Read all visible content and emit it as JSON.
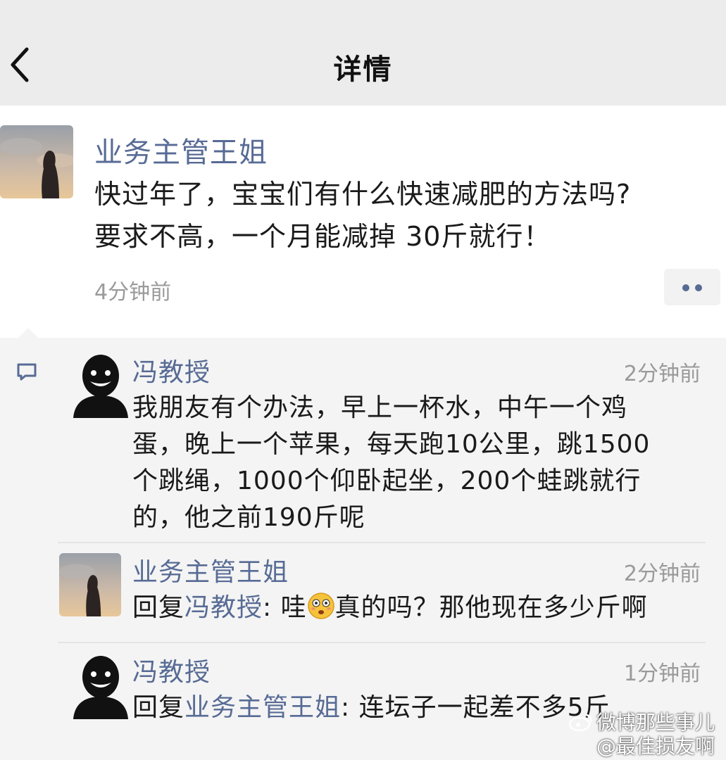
{
  "header": {
    "title": "详情"
  },
  "post": {
    "author": "业务主管王姐",
    "text_line1": "快过年了，宝宝们有什么快速减肥的方法吗?",
    "text_line2": "要求不高，一个月能减掉 30斤就行！",
    "time": "4分钟前"
  },
  "comments": [
    {
      "author": "冯教授",
      "time": "2分钟前",
      "lines": [
        "我朋友有个办法，早上一杯水，中午一个鸡",
        "蛋，晚上一个苹果，每天跑10公里，跳1500",
        "个跳绳，1000个仰卧起坐，200个蛙跳就行",
        "的，他之前190斤呢"
      ]
    },
    {
      "author": "业务主管王姐",
      "time": "2分钟前",
      "reply_prefix": "回复",
      "reply_to": "冯教授",
      "text_a": ": 哇",
      "emoji": "astonished-face-emoji",
      "text_b": "真的吗？那他现在多少斤啊"
    },
    {
      "author": "冯教授",
      "time": "1分钟前",
      "reply_prefix": "回复",
      "reply_to": "业务主管王姐",
      "text_a": ": 连坛子一起差不多5斤"
    }
  ],
  "watermark": {
    "line1": "微博那些事儿",
    "line2": "@最佳损友啊"
  },
  "icons": {
    "back": "chevron-left-icon",
    "more": "more-dots-icon",
    "comment": "comment-bubble-icon"
  },
  "colors": {
    "link": "#576b95",
    "header_bg": "#ececec",
    "comment_bg": "#f4f4f4",
    "time_gray": "#9a9a9a"
  }
}
